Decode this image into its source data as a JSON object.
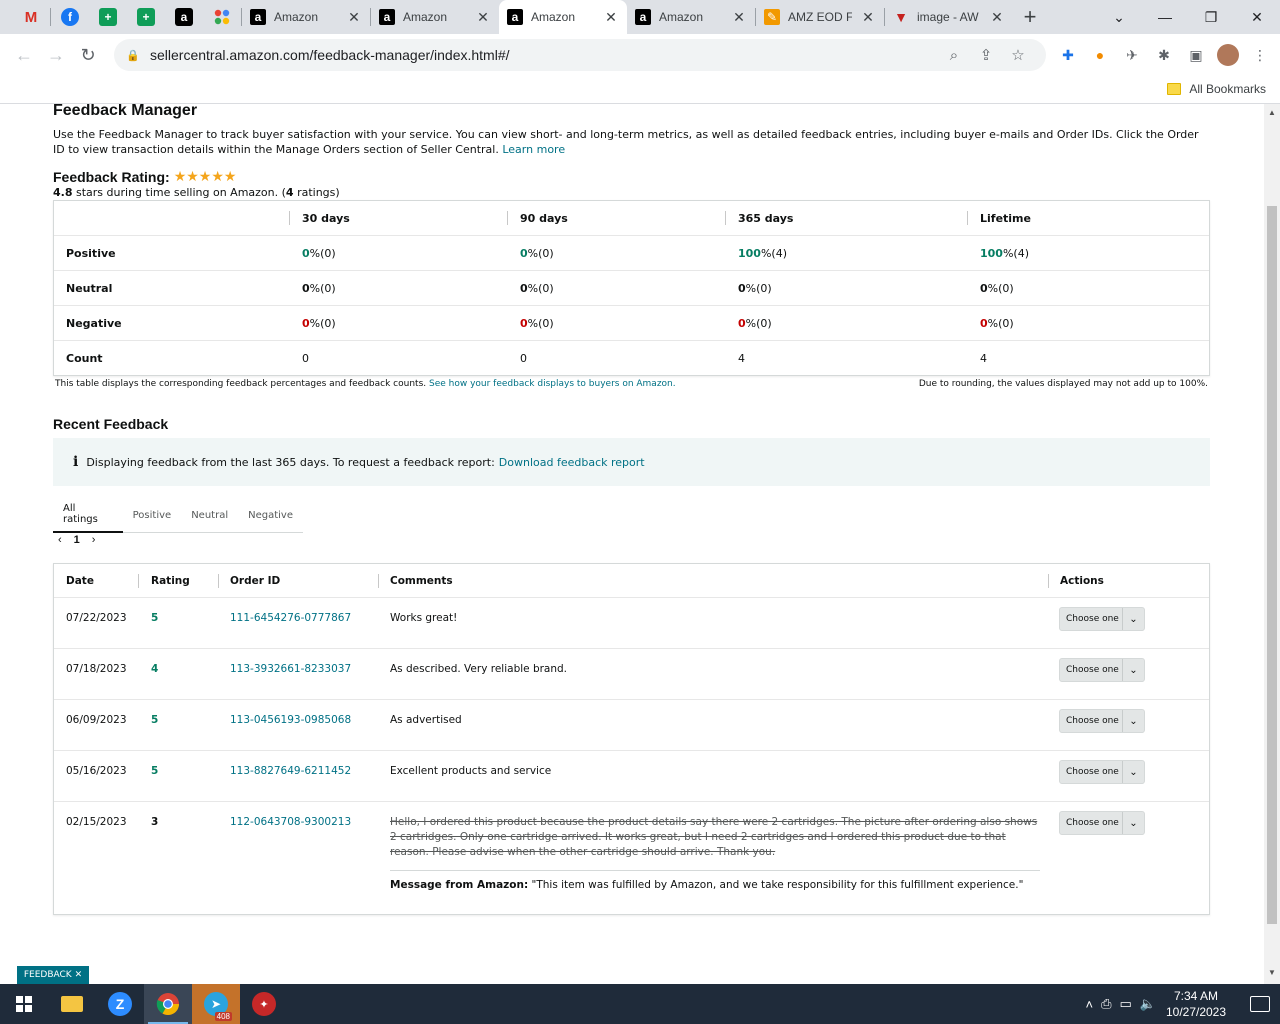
{
  "browser": {
    "tabs": [
      {
        "title": "Amazon",
        "active": false
      },
      {
        "title": "Amazon",
        "active": false
      },
      {
        "title": "Amazon",
        "active": true
      },
      {
        "title": "Amazon",
        "active": false
      },
      {
        "title": "AMZ EOD F",
        "active": false
      },
      {
        "title": "image - AW",
        "active": false
      }
    ],
    "url": "sellercentral.amazon.com/feedback-manager/index.html#/",
    "all_bookmarks": "All Bookmarks"
  },
  "page": {
    "title": "Feedback Manager",
    "intro": "Use the Feedback Manager to track buyer satisfaction with your service. You can view short- and long-term metrics, as well as detailed feedback entries, including buyer e-mails and Order IDs. Click the Order ID to view transaction details within the Manage Orders section of Seller Central.",
    "learn_more": "Learn more",
    "rating_label": "Feedback Rating:",
    "rating_stars": 5,
    "rating_value": "4.8",
    "rating_sub_mid": " stars during time selling on Amazon. (",
    "rating_count": "4",
    "rating_sub_end": " ratings)"
  },
  "summary": {
    "headers": [
      "30 days",
      "90 days",
      "365 days",
      "Lifetime"
    ],
    "rows": [
      {
        "label": "Positive",
        "values": [
          [
            "0",
            " %(0)"
          ],
          [
            "0",
            " %(0)"
          ],
          [
            "100",
            " %(4)"
          ],
          [
            "100",
            " %(4)"
          ]
        ]
      },
      {
        "label": "Neutral",
        "values": [
          [
            "0",
            " %(0)"
          ],
          [
            "0",
            " %(0)"
          ],
          [
            "0",
            " %(0)"
          ],
          [
            "0",
            " %(0)"
          ]
        ]
      },
      {
        "label": "Negative",
        "values": [
          [
            "0",
            " %(0)"
          ],
          [
            "0",
            " %(0)"
          ],
          [
            "0",
            " %(0)"
          ],
          [
            "0",
            " %(0)"
          ]
        ]
      },
      {
        "label": "Count",
        "values": [
          [
            "",
            "0"
          ],
          [
            "",
            "0"
          ],
          [
            "",
            "4"
          ],
          [
            "",
            "4"
          ]
        ]
      }
    ],
    "note": "This table displays the corresponding feedback percentages and feedback counts.",
    "note_link": "See how your feedback displays to buyers on Amazon.",
    "rounding": "Due to rounding, the values displayed may not add up to 100%."
  },
  "recent": {
    "title": "Recent Feedback",
    "info": "Displaying feedback from the last 365 days. To request a feedback report:",
    "info_link": "Download feedback report",
    "tabs": [
      "All ratings",
      "Positive",
      "Neutral",
      "Negative"
    ],
    "page": "1",
    "columns": [
      "Date",
      "Rating",
      "Order ID",
      "Comments",
      "Actions"
    ],
    "action_label": "Choose one",
    "rows": [
      {
        "date": "07/22/2023",
        "rating": "5",
        "order": "111-6454276-0777867",
        "comment": "Works great!"
      },
      {
        "date": "07/18/2023",
        "rating": "4",
        "order": "113-3932661-8233037",
        "comment": "As described. Very reliable brand."
      },
      {
        "date": "06/09/2023",
        "rating": "5",
        "order": "113-0456193-0985068",
        "comment": "As advertised"
      },
      {
        "date": "05/16/2023",
        "rating": "5",
        "order": "113-8827649-6211452",
        "comment": "Excellent products and service"
      },
      {
        "date": "02/15/2023",
        "rating": "3",
        "order": "112-0643708-9300213",
        "comment": "Hello, I ordered this product because the product details say there were 2 cartridges. The picture after ordering also shows 2 cartridges. Only one cartridge arrived. It works great, but I need 2 cartridges and I ordered this product due to that reason. Please advise when the other cartridge should arrive. Thank you."
      }
    ],
    "amazon_msg_label": "Message from Amazon:",
    "amazon_msg": "\"This item was fulfilled by Amazon, and we take responsibility for this fulfillment experience.\""
  },
  "feedback_tag": "FEEDBACK ✕",
  "taskbar": {
    "badge": "408",
    "time": "7:34 AM",
    "date": "10/27/2023"
  },
  "colors": {
    "positive": "#067d62",
    "negative": "#c40000",
    "link": "#007185",
    "star": "#f4a51c"
  }
}
